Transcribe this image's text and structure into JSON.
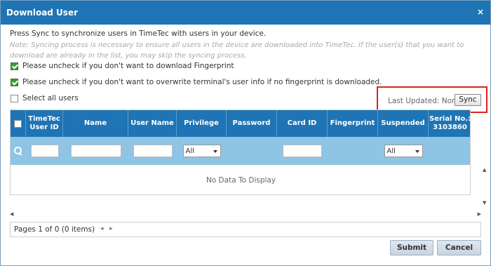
{
  "dialog": {
    "title": "Download User",
    "close_glyph": "×"
  },
  "intro": {
    "text": "Press Sync to synchronize users in TimeTec with users in your device.",
    "note": "Note: Syncing process is necessary to ensure all users in the device are downloaded into TimeTec. If the user(s) that you want to download are already in the list, you may skip the syncing process."
  },
  "options": [
    {
      "label": "Please uncheck if you don't want to download Fingerprint",
      "checked": true
    },
    {
      "label": "Please uncheck if you don't want to overwrite terminal's user info if no fingerprint is downloaded.",
      "checked": true
    }
  ],
  "select_all": {
    "label": "Select all users",
    "checked": false
  },
  "sync": {
    "last_updated_label": "Last Updated: None",
    "button_label": "Sync"
  },
  "grid": {
    "columns": [
      {
        "label": ""
      },
      {
        "label": "TimeTec User ID"
      },
      {
        "label": "Name"
      },
      {
        "label": "User Name"
      },
      {
        "label": "Privilege"
      },
      {
        "label": "Password"
      },
      {
        "label": "Card ID"
      },
      {
        "label": "Fingerprint"
      },
      {
        "label": "Suspended"
      },
      {
        "label": "Serial No.: 3103860"
      }
    ],
    "filters": {
      "privilege": "All",
      "suspended": "All"
    },
    "empty_text": "No Data To Display"
  },
  "pager": {
    "info": "Pages 1 of 0 (0 items)",
    "prev_glyph": "◂",
    "next_glyph": "▸"
  },
  "scroll": {
    "up_glyph": "▲",
    "down_glyph": "▼",
    "left_glyph": "◀",
    "right_glyph": "▶"
  },
  "footer": {
    "submit_label": "Submit",
    "cancel_label": "Cancel"
  },
  "colors": {
    "titlebar": "#1e74b4",
    "filter_row": "#8ec4e4",
    "checkbox_checked": "#3a9b3a",
    "highlight": "#e02020"
  }
}
